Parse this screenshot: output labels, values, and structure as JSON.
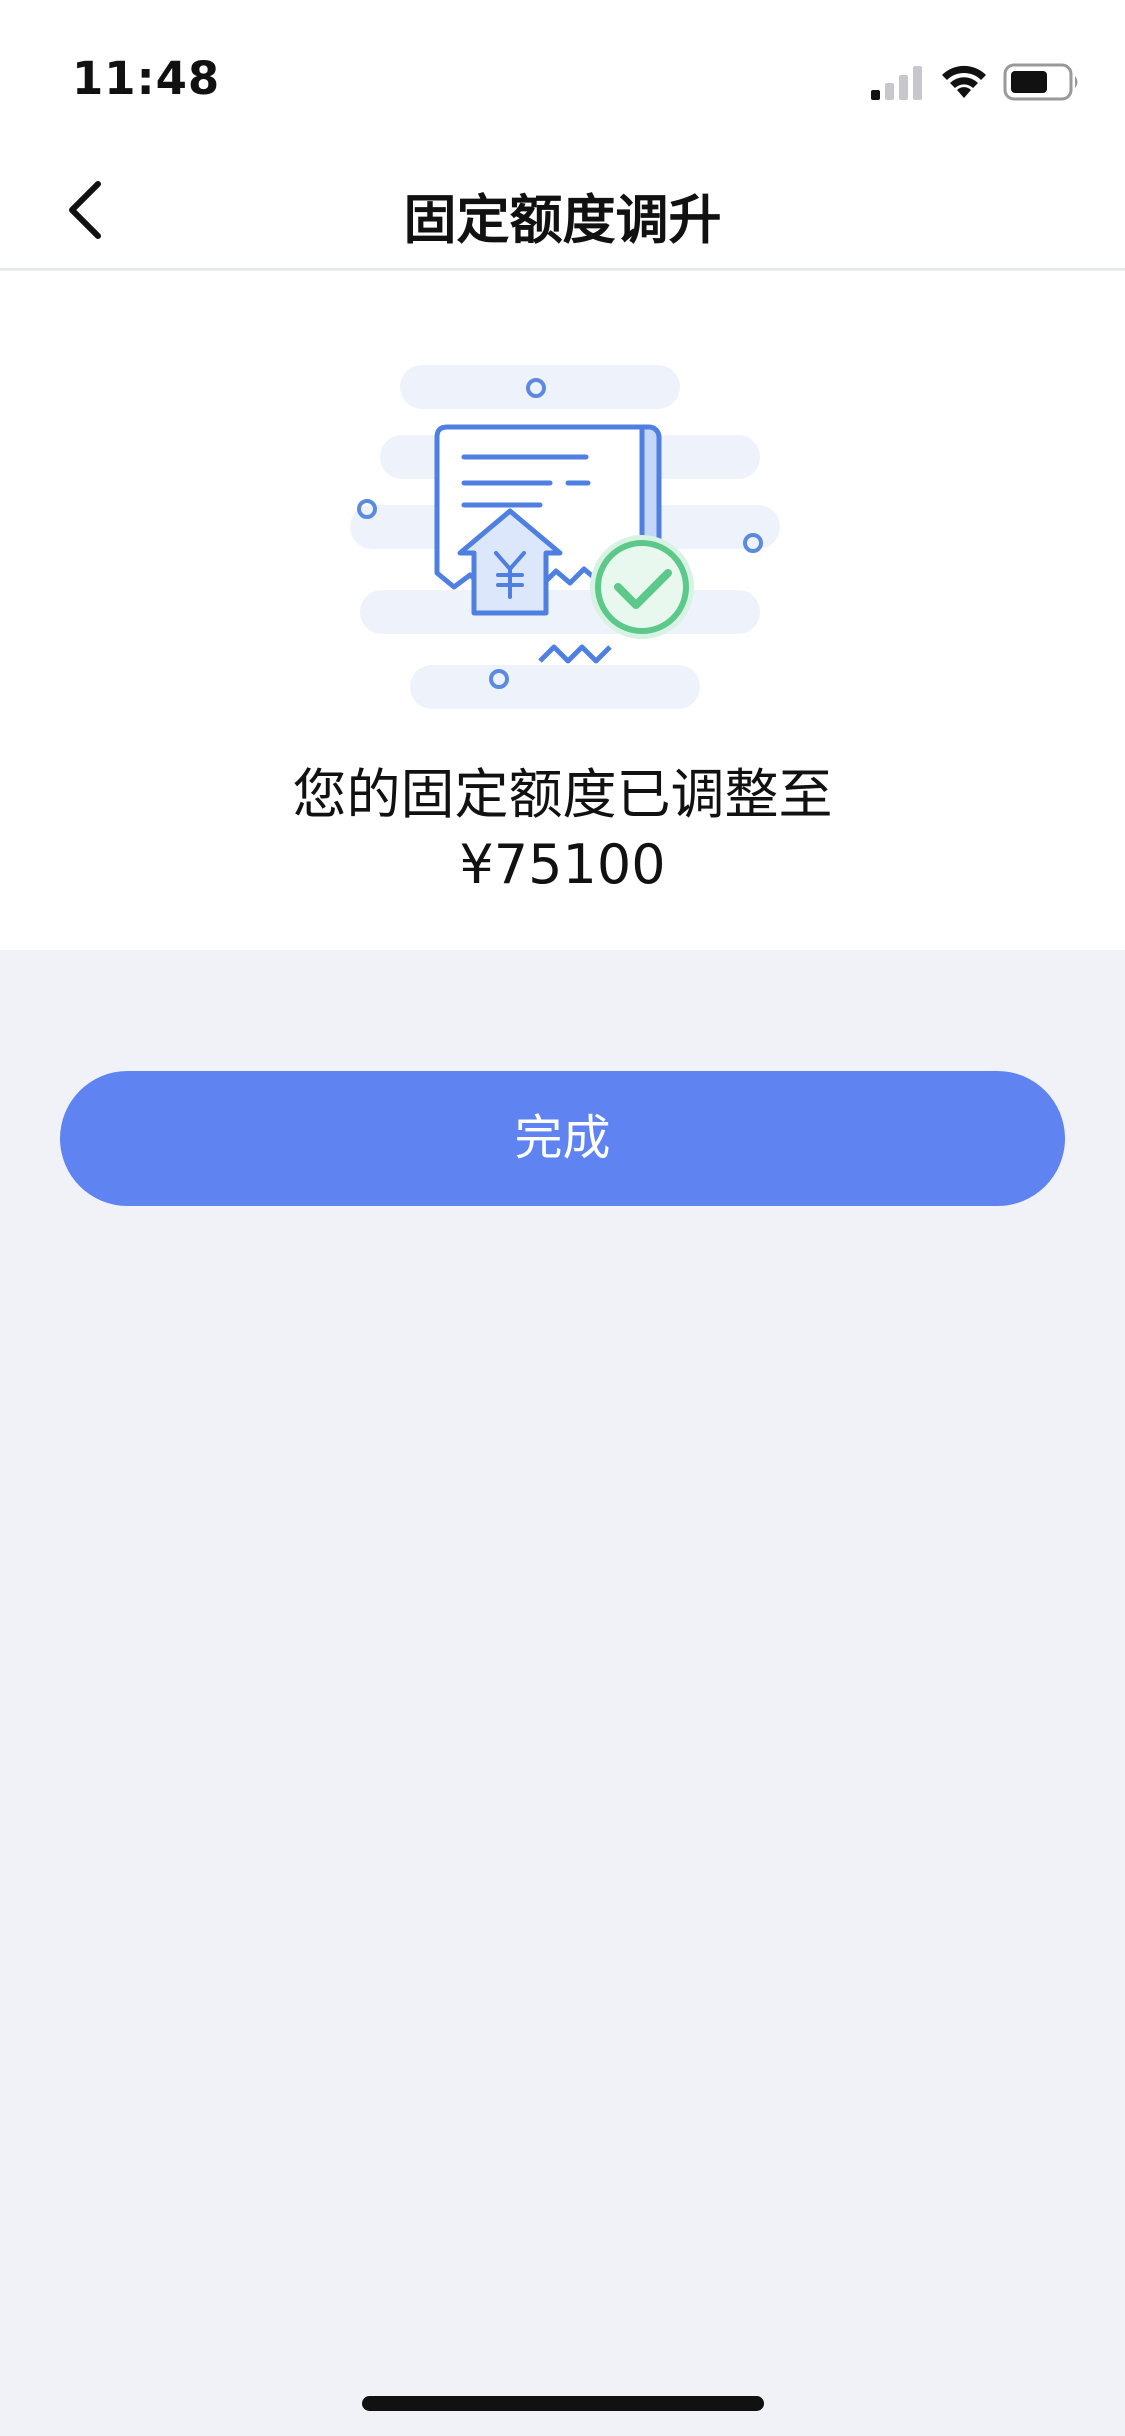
{
  "status_bar": {
    "time": "11:48",
    "icons": [
      "cellular-signal-icon",
      "wifi-icon",
      "battery-icon"
    ]
  },
  "nav": {
    "title": "固定额度调升",
    "back_icon": "chevron-left-icon"
  },
  "result": {
    "illustration": "receipt-limit-increase-success-illustration",
    "message": "您的固定额度已调整至",
    "amount": "¥75100"
  },
  "actions": {
    "done_label": "完成"
  },
  "colors": {
    "accent": "#5f84f2",
    "success": "#5cc98a",
    "page_background": "#f0f2f7",
    "card_background": "#ffffff"
  }
}
